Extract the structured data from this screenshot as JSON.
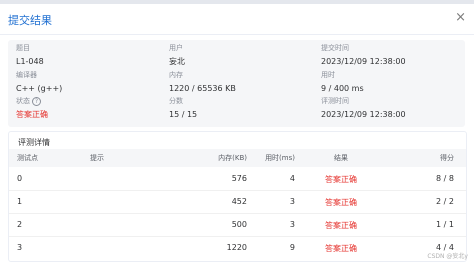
{
  "dialog": {
    "title": "提交结果",
    "close_glyph": "×"
  },
  "info": {
    "problem_label": "题目",
    "problem_value": "L1-048",
    "user_label": "用户",
    "user_value": "妄北",
    "submit_time_label": "提交时间",
    "submit_time_value": "2023/12/09 12:38:00",
    "compiler_label": "编译器",
    "compiler_value": "C++ (g++)",
    "memory_label": "内存",
    "memory_value": "1220 / 65536 KB",
    "time_label": "用时",
    "time_value": "9 / 400 ms",
    "status_label": "状态",
    "status_help_glyph": "?",
    "status_value": "答案正确",
    "score_label": "分数",
    "score_value": "15 / 15",
    "judge_time_label": "评测时间",
    "judge_time_value": "2023/12/09 12:38:00"
  },
  "details": {
    "title": "评测详情",
    "headers": [
      "测试点",
      "提示",
      "内存(KB)",
      "用时(ms)",
      "结果",
      "得分"
    ],
    "rows": [
      {
        "case": "0",
        "hint": "",
        "memory": "576",
        "time": "4",
        "result": "答案正确",
        "score": "8 / 8"
      },
      {
        "case": "1",
        "hint": "",
        "memory": "452",
        "time": "3",
        "result": "答案正确",
        "score": "2 / 2"
      },
      {
        "case": "2",
        "hint": "",
        "memory": "500",
        "time": "3",
        "result": "答案正确",
        "score": "1 / 1"
      },
      {
        "case": "3",
        "hint": "",
        "memory": "1220",
        "time": "9",
        "result": "答案正确",
        "score": "4 / 4"
      }
    ]
  },
  "watermark": "CSDN @妄北y",
  "colors": {
    "accent": "#1f6fd1",
    "success_text": "#e5322d",
    "info_bg": "#f5f6f8"
  }
}
